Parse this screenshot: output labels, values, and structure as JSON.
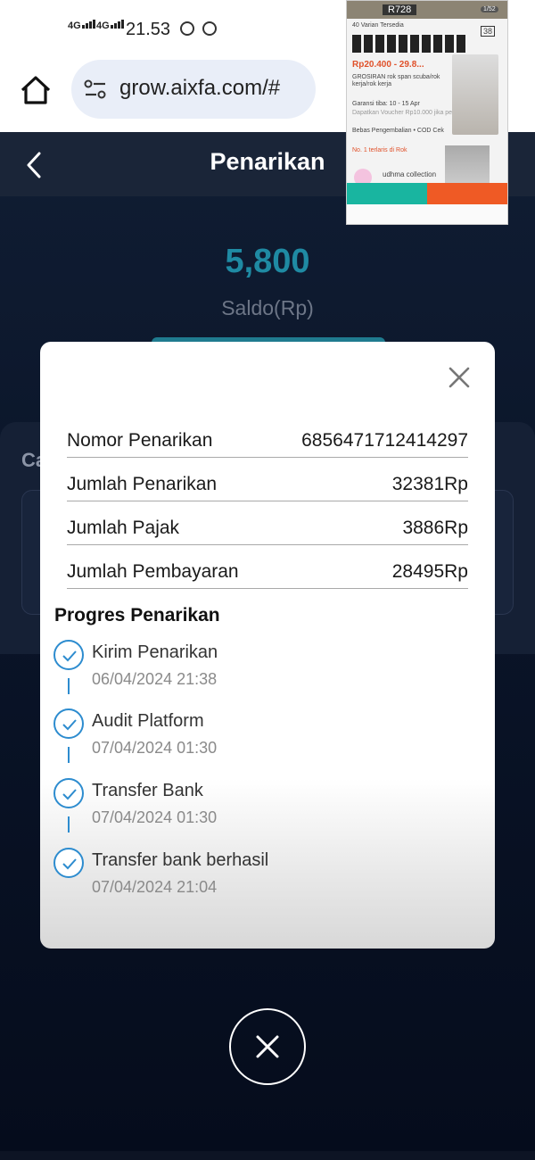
{
  "status_bar": {
    "network_1": "4G",
    "network_2": "4G",
    "time": "21.53",
    "icons": [
      "signal-icon",
      "signal-icon",
      "whatsapp-icon",
      "whatsapp-icon"
    ]
  },
  "browser": {
    "url": "grow.aixfa.com/#"
  },
  "header": {
    "title": "Penarikan"
  },
  "balance": {
    "amount": "5,800",
    "label": "Saldo(Rp)"
  },
  "panel": {
    "label_partial": "Ca"
  },
  "pip": {
    "code": "R728",
    "count": "1/52",
    "variants": "40 Varian Tersedia",
    "price": "Rp20.400 - 29.8...",
    "product": "GROSIRAN rok span scuba/rok kerja/rok kerja",
    "shipping": "Garansi tiba: 10 - 15 Apr",
    "voucher": "Dapatkan Voucher Rp10.000 jika pesanan...",
    "returns": "Bebas Pengembalian • COD Cek",
    "rank": "No. 1 terlaris di Rok",
    "shop": "udhma collection",
    "badge": "38"
  },
  "modal": {
    "rows": [
      {
        "label": "Nomor Penarikan",
        "value": "6856471712414297"
      },
      {
        "label": "Jumlah Penarikan",
        "value": "32381Rp"
      },
      {
        "label": "Jumlah Pajak",
        "value": "3886Rp"
      },
      {
        "label": "Jumlah Pembayaran",
        "value": "28495Rp"
      }
    ],
    "progress_title": "Progres Penarikan",
    "steps": [
      {
        "title": "Kirim Penarikan",
        "date": "06/04/2024 21:38"
      },
      {
        "title": "Audit Platform",
        "date": "07/04/2024 01:30"
      },
      {
        "title": "Transfer Bank",
        "date": "07/04/2024 01:30"
      },
      {
        "title": "Transfer bank berhasil",
        "date": "07/04/2024 21:04"
      }
    ],
    "accent_color": "#2d8ccf"
  },
  "colors": {
    "balance": "#1f8aa3",
    "background": "#0a1428",
    "header": "#1a2538"
  }
}
